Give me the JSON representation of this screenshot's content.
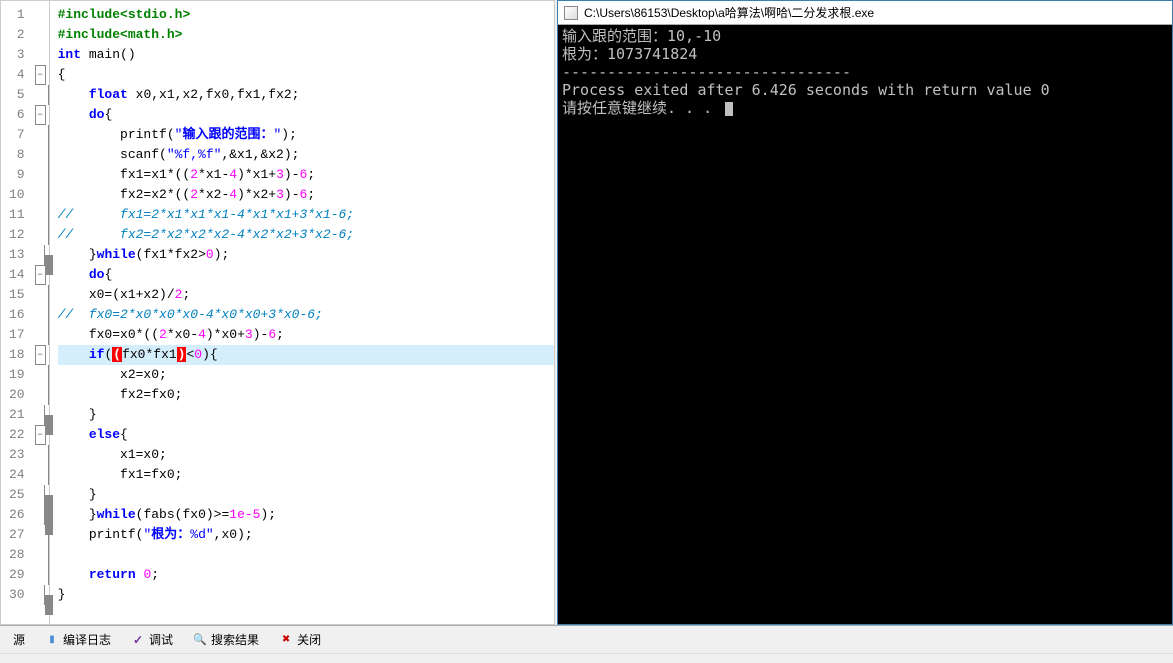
{
  "editor": {
    "lines": [
      {
        "n": 1,
        "fold": "",
        "segs": [
          {
            "c": "pp",
            "t": "#include"
          },
          {
            "c": "pp",
            "t": "<stdio.h>"
          }
        ]
      },
      {
        "n": 2,
        "fold": "",
        "segs": [
          {
            "c": "pp",
            "t": "#include"
          },
          {
            "c": "pp",
            "t": "<math.h>"
          }
        ]
      },
      {
        "n": 3,
        "fold": "",
        "segs": [
          {
            "c": "kw",
            "t": "int"
          },
          {
            "c": "",
            "t": " "
          },
          {
            "c": "fn",
            "t": "main"
          },
          {
            "c": "paren",
            "t": "()"
          }
        ]
      },
      {
        "n": 4,
        "fold": "box",
        "segs": [
          {
            "c": "op",
            "t": "{"
          }
        ]
      },
      {
        "n": 5,
        "fold": "line",
        "segs": [
          {
            "c": "",
            "t": "    "
          },
          {
            "c": "kw",
            "t": "float"
          },
          {
            "c": "",
            "t": " x0,x1,x2,fx0,fx1,fx2;"
          }
        ]
      },
      {
        "n": 6,
        "fold": "box",
        "segs": [
          {
            "c": "",
            "t": "    "
          },
          {
            "c": "kw",
            "t": "do"
          },
          {
            "c": "op",
            "t": "{"
          }
        ]
      },
      {
        "n": 7,
        "fold": "line",
        "segs": [
          {
            "c": "",
            "t": "        printf("
          },
          {
            "c": "str",
            "t": "\""
          },
          {
            "c": "str-cn",
            "t": "输入跟的范围："
          },
          {
            "c": "str",
            "t": "\""
          },
          {
            "c": "",
            "t": ");"
          }
        ]
      },
      {
        "n": 8,
        "fold": "line",
        "segs": [
          {
            "c": "",
            "t": "        scanf("
          },
          {
            "c": "str",
            "t": "\"%f,%f\""
          },
          {
            "c": "",
            "t": ",&x1,&x2);"
          }
        ]
      },
      {
        "n": 9,
        "fold": "line",
        "segs": [
          {
            "c": "",
            "t": "        fx1=x1*(("
          },
          {
            "c": "num",
            "t": "2"
          },
          {
            "c": "",
            "t": "*x1-"
          },
          {
            "c": "num",
            "t": "4"
          },
          {
            "c": "",
            "t": ")*x1+"
          },
          {
            "c": "num",
            "t": "3"
          },
          {
            "c": "",
            "t": ")-"
          },
          {
            "c": "num",
            "t": "6"
          },
          {
            "c": "",
            "t": ";"
          }
        ]
      },
      {
        "n": 10,
        "fold": "line",
        "segs": [
          {
            "c": "",
            "t": "        fx2=x2*(("
          },
          {
            "c": "num",
            "t": "2"
          },
          {
            "c": "",
            "t": "*x2-"
          },
          {
            "c": "num",
            "t": "4"
          },
          {
            "c": "",
            "t": ")*x2+"
          },
          {
            "c": "num",
            "t": "3"
          },
          {
            "c": "",
            "t": ")-"
          },
          {
            "c": "num",
            "t": "6"
          },
          {
            "c": "",
            "t": ";"
          }
        ]
      },
      {
        "n": 11,
        "fold": "line",
        "segs": [
          {
            "c": "cmt",
            "t": "//      fx1=2*x1*x1*x1-4*x1*x1+3*x1-6;"
          }
        ]
      },
      {
        "n": 12,
        "fold": "line",
        "segs": [
          {
            "c": "cmt",
            "t": "//      fx2=2*x2*x2*x2-4*x2*x2+3*x2-6;"
          }
        ]
      },
      {
        "n": 13,
        "fold": "end",
        "segs": [
          {
            "c": "",
            "t": "    "
          },
          {
            "c": "op",
            "t": "}"
          },
          {
            "c": "kw",
            "t": "while"
          },
          {
            "c": "",
            "t": "(fx1*fx2>"
          },
          {
            "c": "num",
            "t": "0"
          },
          {
            "c": "",
            "t": ");"
          }
        ]
      },
      {
        "n": 14,
        "fold": "box",
        "segs": [
          {
            "c": "",
            "t": "    "
          },
          {
            "c": "kw",
            "t": "do"
          },
          {
            "c": "op",
            "t": "{"
          }
        ]
      },
      {
        "n": 15,
        "fold": "line",
        "segs": [
          {
            "c": "",
            "t": "    x0=(x1+x2)/"
          },
          {
            "c": "num",
            "t": "2"
          },
          {
            "c": "",
            "t": ";"
          }
        ]
      },
      {
        "n": 16,
        "fold": "line",
        "segs": [
          {
            "c": "cmt",
            "t": "//  fx0=2*x0*x0*x0-4*x0*x0+3*x0-6;"
          }
        ]
      },
      {
        "n": 17,
        "fold": "line",
        "segs": [
          {
            "c": "",
            "t": "    fx0=x0*(("
          },
          {
            "c": "num",
            "t": "2"
          },
          {
            "c": "",
            "t": "*x0-"
          },
          {
            "c": "num",
            "t": "4"
          },
          {
            "c": "",
            "t": ")*x0+"
          },
          {
            "c": "num",
            "t": "3"
          },
          {
            "c": "",
            "t": ")-"
          },
          {
            "c": "num",
            "t": "6"
          },
          {
            "c": "",
            "t": ";"
          }
        ]
      },
      {
        "n": 18,
        "fold": "box",
        "hl": true,
        "segs": [
          {
            "c": "",
            "t": "    "
          },
          {
            "c": "kw",
            "t": "if"
          },
          {
            "c": "",
            "t": "("
          },
          {
            "c": "hl-paren",
            "t": "("
          },
          {
            "c": "",
            "t": "fx0*fx1"
          },
          {
            "c": "hl-paren",
            "t": ")"
          },
          {
            "c": "",
            "t": "<"
          },
          {
            "c": "num",
            "t": "0"
          },
          {
            "c": "",
            "t": ")"
          },
          {
            "c": "op",
            "t": "{"
          }
        ]
      },
      {
        "n": 19,
        "fold": "line",
        "segs": [
          {
            "c": "",
            "t": "        x2=x0;"
          }
        ]
      },
      {
        "n": 20,
        "fold": "line",
        "segs": [
          {
            "c": "",
            "t": "        fx2=fx0;"
          }
        ]
      },
      {
        "n": 21,
        "fold": "end",
        "segs": [
          {
            "c": "",
            "t": "    "
          },
          {
            "c": "op",
            "t": "}"
          }
        ]
      },
      {
        "n": 22,
        "fold": "box",
        "segs": [
          {
            "c": "",
            "t": "    "
          },
          {
            "c": "kw",
            "t": "else"
          },
          {
            "c": "op",
            "t": "{"
          }
        ]
      },
      {
        "n": 23,
        "fold": "line",
        "segs": [
          {
            "c": "",
            "t": "        x1=x0;"
          }
        ]
      },
      {
        "n": 24,
        "fold": "line",
        "segs": [
          {
            "c": "",
            "t": "        fx1=fx0;"
          }
        ]
      },
      {
        "n": 25,
        "fold": "end",
        "segs": [
          {
            "c": "",
            "t": "    "
          },
          {
            "c": "op",
            "t": "}"
          }
        ]
      },
      {
        "n": 26,
        "fold": "end",
        "segs": [
          {
            "c": "",
            "t": "    "
          },
          {
            "c": "op",
            "t": "}"
          },
          {
            "c": "kw",
            "t": "while"
          },
          {
            "c": "",
            "t": "(fabs(fx0)>="
          },
          {
            "c": "num",
            "t": "1e-5"
          },
          {
            "c": "",
            "t": ");"
          }
        ]
      },
      {
        "n": 27,
        "fold": "line",
        "segs": [
          {
            "c": "",
            "t": "    printf("
          },
          {
            "c": "str",
            "t": "\""
          },
          {
            "c": "str-cn",
            "t": "根为："
          },
          {
            "c": "str",
            "t": "%d\""
          },
          {
            "c": "",
            "t": ",x0);"
          }
        ]
      },
      {
        "n": 28,
        "fold": "line",
        "segs": [
          {
            "c": "",
            "t": ""
          }
        ]
      },
      {
        "n": 29,
        "fold": "line",
        "segs": [
          {
            "c": "",
            "t": "    "
          },
          {
            "c": "kw",
            "t": "return"
          },
          {
            "c": "",
            "t": " "
          },
          {
            "c": "num",
            "t": "0"
          },
          {
            "c": "",
            "t": ";"
          }
        ]
      },
      {
        "n": 30,
        "fold": "end",
        "segs": [
          {
            "c": "op",
            "t": "}"
          }
        ]
      }
    ]
  },
  "console": {
    "title": "C:\\Users\\86153\\Desktop\\a哈算法\\啊哈\\二分发求根.exe",
    "lines": [
      "输入跟的范围：10,-10",
      "根为：1073741824",
      "--------------------------------",
      "Process exited after 6.426 seconds with return value 0",
      "请按任意键继续. . . "
    ]
  },
  "tabs": {
    "resource": "源",
    "compile_log": "编译日志",
    "debug": "调试",
    "search_results": "搜索结果",
    "close": "关闭"
  }
}
